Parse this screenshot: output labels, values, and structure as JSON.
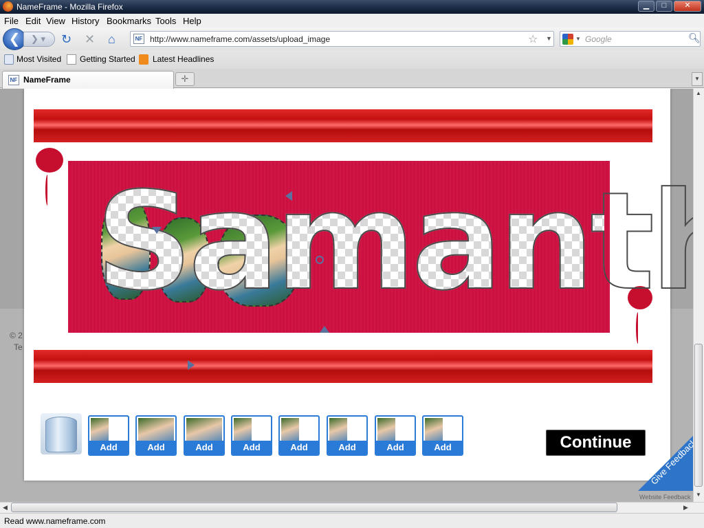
{
  "window": {
    "title": "NameFrame - Mozilla Firefox",
    "min": "▁",
    "max": "□",
    "close": "✕"
  },
  "menu": [
    "File",
    "Edit",
    "View",
    "History",
    "Bookmarks",
    "Tools",
    "Help"
  ],
  "nav": {
    "back_icon": "arrow-left-icon",
    "url": "http://www.nameframe.com/assets/upload_image",
    "favicon": "NF",
    "search_placeholder": "Google"
  },
  "bookmarks": [
    "Most Visited",
    "Getting Started",
    "Latest Headlines"
  ],
  "tabs": [
    {
      "label": "NameFrame"
    }
  ],
  "page": {
    "name_text": "Samantha",
    "add_label": "Add",
    "thumb_count": 8,
    "continue_label": "Continue",
    "footer_copy": "© 2",
    "footer_te": "Te"
  },
  "feedback": {
    "label": "Give Feedback",
    "sub": "Website Feedback"
  },
  "status": "Read www.nameframe.com",
  "colors": {
    "red": "#c60f2f",
    "blue": "#2a7ad8",
    "stage": "#cc1040"
  }
}
